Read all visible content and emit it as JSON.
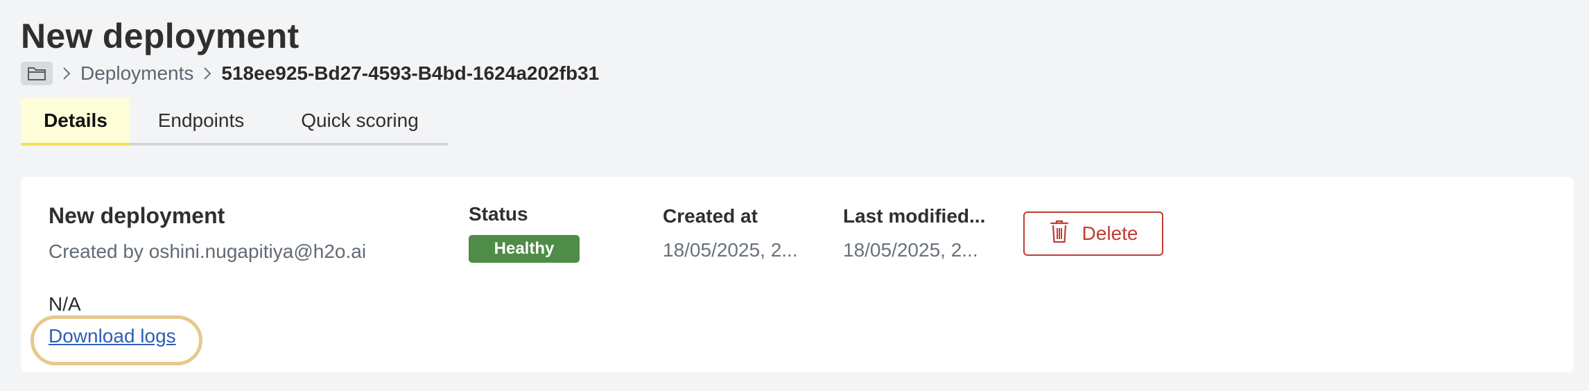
{
  "header": {
    "title": "New deployment"
  },
  "breadcrumb": {
    "root_icon": "folder-icon",
    "items": [
      "Deployments",
      "518ee925-Bd27-4593-B4bd-1624a202fb31"
    ]
  },
  "tabs": [
    {
      "label": "Details",
      "active": true
    },
    {
      "label": "Endpoints",
      "active": false
    },
    {
      "label": "Quick scoring",
      "active": false
    }
  ],
  "card": {
    "title": "New deployment",
    "subtitle": "Created by oshini.nugapitiya@h2o.ai",
    "status_label": "Status",
    "status_value": "Healthy",
    "created_label": "Created at",
    "created_value": "18/05/2025, 2...",
    "modified_label": "Last modified...",
    "modified_value": "18/05/2025, 2...",
    "delete_label": "Delete",
    "description": "N/A",
    "download_logs": "Download logs"
  },
  "colors": {
    "status_healthy": "#4e8c47",
    "danger": "#c23b33",
    "link": "#2d5fb8",
    "active_tab_bg": "#fdfdd8",
    "highlight": "#e7c98a"
  }
}
